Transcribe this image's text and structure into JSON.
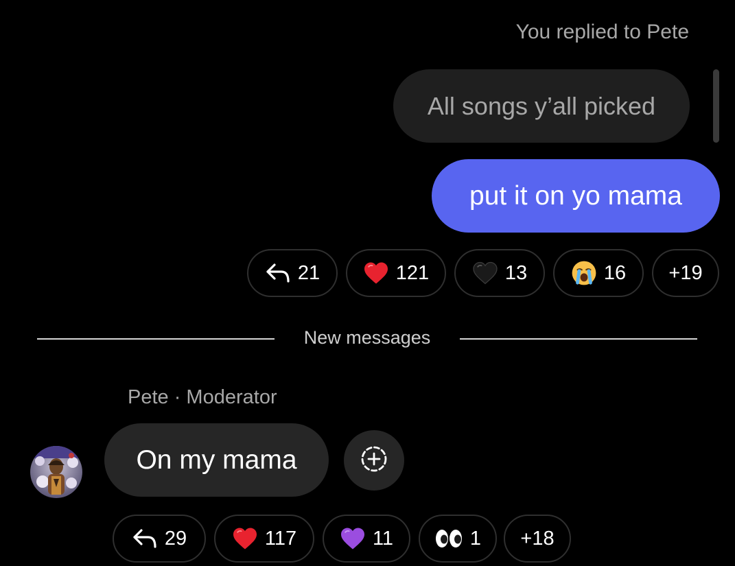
{
  "thread": {
    "reply_context": "You replied to Pete",
    "quoted_message": "All songs y’all picked",
    "own_message": "put it on yo mama",
    "own_reactions": [
      {
        "icon": "reply-icon",
        "count": "21"
      },
      {
        "icon": "red-heart-icon",
        "count": "121"
      },
      {
        "icon": "black-heart-icon",
        "count": "13"
      },
      {
        "icon": "crying-face-icon",
        "count": "16"
      },
      {
        "icon": "",
        "count": "+19"
      }
    ],
    "divider_label": "New messages",
    "incoming": {
      "sender": "Pete · Moderator",
      "message": "On my mama",
      "reactions": [
        {
          "icon": "reply-icon",
          "count": "29"
        },
        {
          "icon": "red-heart-icon",
          "count": "117"
        },
        {
          "icon": "purple-heart-icon",
          "count": "11"
        },
        {
          "icon": "eyes-icon",
          "count": "1"
        },
        {
          "icon": "",
          "count": "+18"
        }
      ]
    }
  },
  "colors": {
    "background": "#000000",
    "own_bubble": "#5865f0",
    "incoming_bubble": "#262626",
    "quoted_bubble": "#1f1f1f",
    "red_heart": "#e8232f",
    "purple_heart": "#9b4de0"
  }
}
